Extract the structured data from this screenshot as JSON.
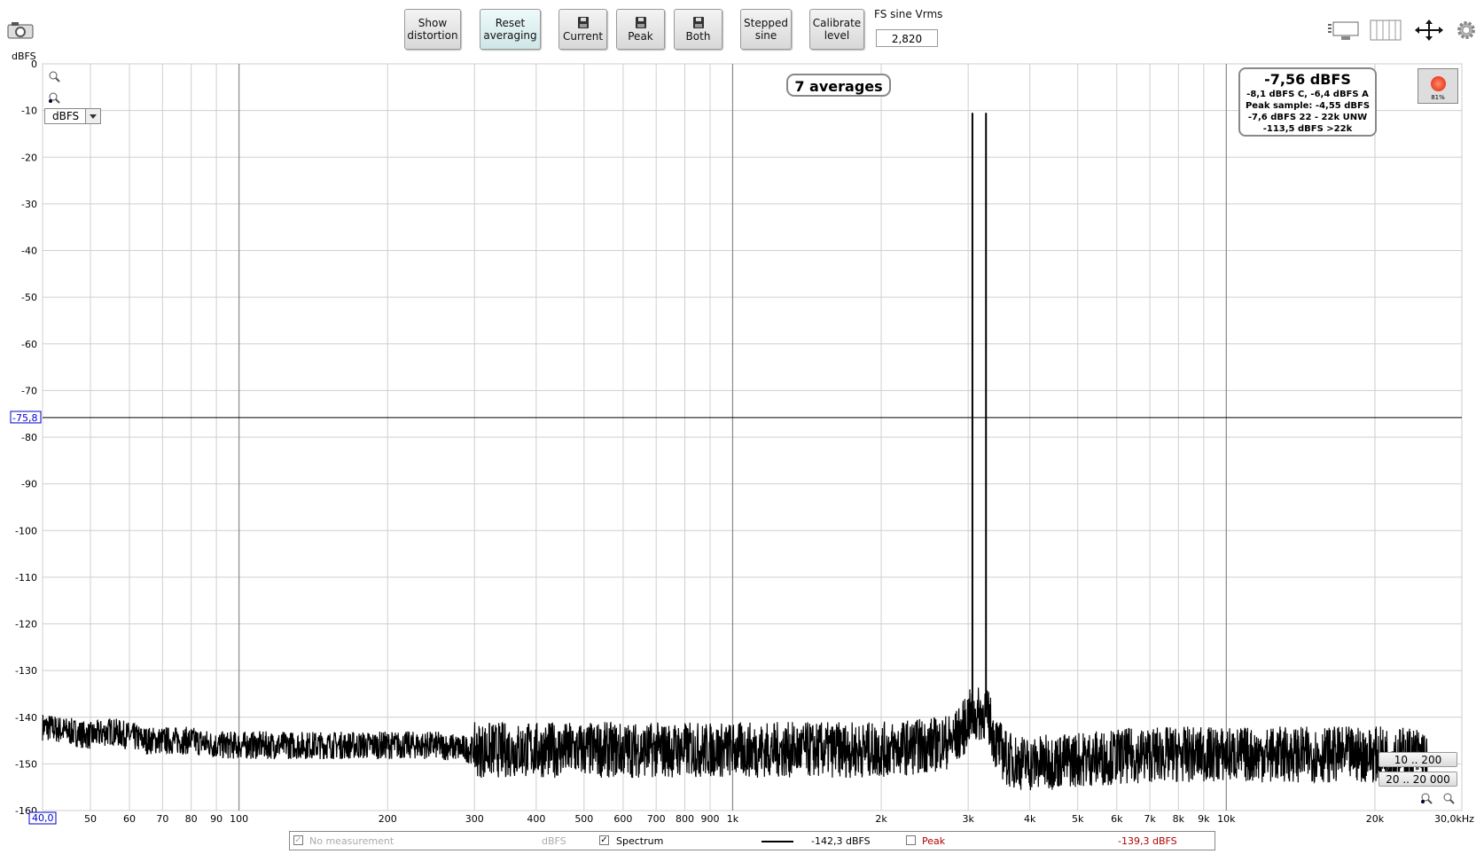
{
  "toolbar": {
    "show_distortion": [
      "Show",
      "distortion"
    ],
    "reset_averaging": [
      "Reset",
      "averaging"
    ],
    "current_label": "Current",
    "peak_label": "Peak",
    "both_label": "Both",
    "stepped_sine": [
      "Stepped",
      "sine"
    ],
    "calibrate_level": [
      "Calibrate",
      "level"
    ],
    "fs_sine_label": "FS sine Vrms",
    "fs_sine_value": "2,820"
  },
  "icons": [
    "camera-icon",
    "floppy-disk-icon",
    "window-layout-icon",
    "columns-icon",
    "move-arrows-icon",
    "gear-icon",
    "zoom-in-icon",
    "zoom-out-icon"
  ],
  "unit_selector": "dBFS",
  "averages_badge": "7 averages",
  "level_readout": {
    "main": "-7,56 dBFS",
    "lines": [
      "-8,1 dBFS C, -6,4 dBFS A",
      "Peak sample: -4,55 dBFS",
      "-7,6 dBFS 22 - 22k UNW",
      "-113,5 dBFS >22k"
    ]
  },
  "record_meter": "81%",
  "range_buttons": [
    "10 .. 200",
    "20 .. 20 000"
  ],
  "legend": {
    "no_measurement": "No measurement",
    "no_measurement_unit": "dBFS",
    "spectrum": "Spectrum",
    "spectrum_value": "-142,3 dBFS",
    "peak": "Peak",
    "peak_value": "-139,3 dBFS",
    "peak_color": "#b00000"
  },
  "chart_data": {
    "type": "line",
    "ylabel": "dBFS",
    "xlim": [
      40,
      30000
    ],
    "ylim": [
      -160,
      0
    ],
    "xscale": "log",
    "grid": true,
    "yticks": [
      0,
      -10,
      -20,
      -30,
      -40,
      -50,
      -60,
      -70,
      -80,
      -90,
      -100,
      -110,
      -120,
      -130,
      -140,
      -150,
      -160
    ],
    "ytick_labels": [
      "0",
      "-10",
      "-20",
      "-30",
      "-40",
      "-50",
      "-60",
      "-70",
      "-80",
      "-90",
      "-100",
      "-110",
      "-120",
      "-130",
      "-140",
      "-150",
      "-160"
    ],
    "xticks": [
      50,
      60,
      70,
      80,
      90,
      100,
      200,
      300,
      400,
      500,
      600,
      700,
      800,
      900,
      1000,
      2000,
      3000,
      4000,
      5000,
      6000,
      7000,
      8000,
      9000,
      10000,
      20000
    ],
    "xtick_labels": [
      "50",
      "60",
      "70",
      "80",
      "90",
      "100",
      "200",
      "300",
      "400",
      "500",
      "600",
      "700",
      "800",
      "900",
      "1k",
      "2k",
      "3k",
      "4k",
      "5k",
      "6k",
      "7k",
      "8k",
      "9k",
      "10k",
      "20k"
    ],
    "x_start_label": "40,0",
    "x_end_label": "30,0kHz",
    "cursor_y": -75.8,
    "cursor_label": "-75,8",
    "series": [
      {
        "name": "Spectrum",
        "color": "#000000",
        "x": [
          40,
          45,
          50,
          55,
          60,
          65,
          70,
          80,
          90,
          100,
          120,
          150,
          200,
          250,
          300,
          400,
          500,
          700,
          1000,
          1500,
          2000,
          2500,
          2800,
          2950,
          3000,
          3060,
          3100,
          3200,
          3260,
          3300,
          3400,
          3600,
          4000,
          5000,
          7000,
          10000,
          15000,
          20000,
          25000,
          25500
        ],
        "y": [
          -142,
          -143,
          -144,
          -143,
          -144,
          -145,
          -145,
          -145,
          -146,
          -146,
          -146,
          -146,
          -146,
          -146,
          -147,
          -147,
          -147,
          -147,
          -147,
          -147,
          -147,
          -146,
          -145,
          -142,
          -140,
          -10.5,
          -140,
          -139,
          -10.5,
          -140,
          -145,
          -149,
          -150,
          -149,
          -148,
          -148,
          -148,
          -148,
          -148,
          -150
        ]
      }
    ],
    "peaks": [
      {
        "x": 3060,
        "y": -10.5
      },
      {
        "x": 3260,
        "y": -10.5
      }
    ]
  }
}
